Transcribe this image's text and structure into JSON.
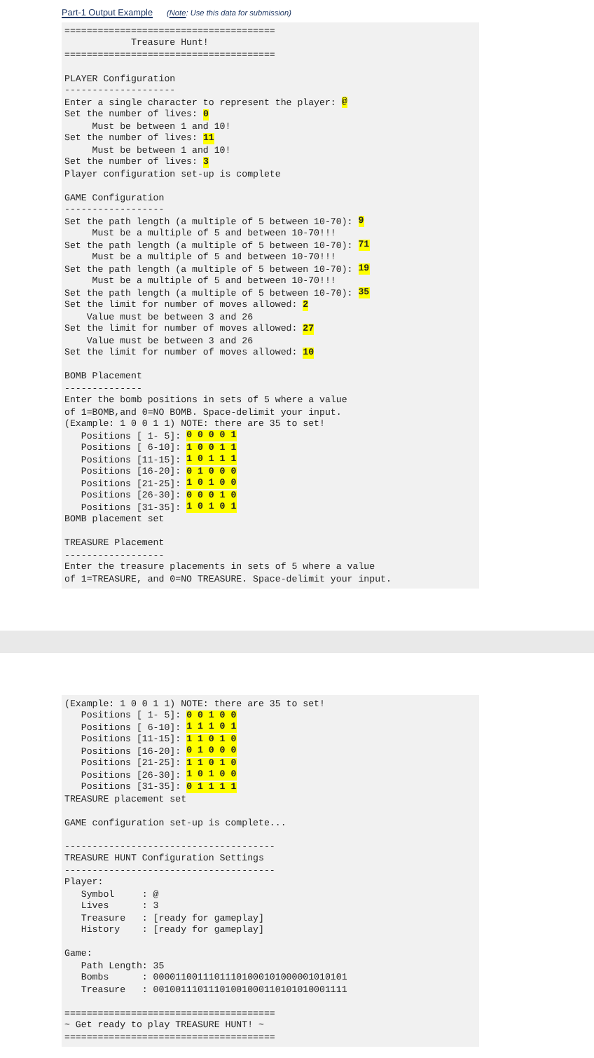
{
  "header": {
    "title": "Part-1 Output Example",
    "note": {
      "open": "(",
      "label": "Note",
      "rest": ": Use this data for submission)"
    }
  },
  "pages": [
    {
      "sections": [
        {
          "lines": [
            {
              "text": "======================================"
            },
            {
              "text": "            Treasure Hunt!"
            },
            {
              "text": "======================================"
            }
          ]
        },
        {
          "lines": [
            {
              "text": "PLAYER Configuration"
            },
            {
              "text": "--------------------"
            },
            {
              "text": "Enter a single character to represent the player: ",
              "input": "@"
            },
            {
              "text": "Set the number of lives: ",
              "input": "0"
            },
            {
              "text": "     Must be between 1 and 10!"
            },
            {
              "text": "Set the number of lives: ",
              "input": "11"
            },
            {
              "text": "     Must be between 1 and 10!"
            },
            {
              "text": "Set the number of lives: ",
              "input": "3"
            },
            {
              "text": "Player configuration set-up is complete"
            }
          ]
        },
        {
          "lines": [
            {
              "text": "GAME Configuration"
            },
            {
              "text": "------------------"
            },
            {
              "text": "Set the path length (a multiple of 5 between 10-70): ",
              "input": "9"
            },
            {
              "text": "     Must be a multiple of 5 and between 10-70!!!"
            },
            {
              "text": "Set the path length (a multiple of 5 between 10-70): ",
              "input": "71"
            },
            {
              "text": "     Must be a multiple of 5 and between 10-70!!!"
            },
            {
              "text": "Set the path length (a multiple of 5 between 10-70): ",
              "input": "19"
            },
            {
              "text": "     Must be a multiple of 5 and between 10-70!!!"
            },
            {
              "text": "Set the path length (a multiple of 5 between 10-70): ",
              "input": "35"
            },
            {
              "text": "Set the limit for number of moves allowed: ",
              "input": "2"
            },
            {
              "text": "    Value must be between 3 and 26"
            },
            {
              "text": "Set the limit for number of moves allowed: ",
              "input": "27"
            },
            {
              "text": "    Value must be between 3 and 26"
            },
            {
              "text": "Set the limit for number of moves allowed: ",
              "input": "10"
            }
          ]
        },
        {
          "lines": [
            {
              "text": "BOMB Placement"
            },
            {
              "text": "--------------"
            },
            {
              "text": "Enter the bomb positions in sets of 5 where a value"
            },
            {
              "text": "of 1=BOMB,and 0=NO BOMB. Space-delimit your input."
            },
            {
              "text": "(Example: 1 0 0 1 1) NOTE: there are 35 to set!"
            },
            {
              "text": "   Positions [ 1- 5]: ",
              "input": "0 0 0 0 1"
            },
            {
              "text": "   Positions [ 6-10]: ",
              "input": "1 0 0 1 1"
            },
            {
              "text": "   Positions [11-15]: ",
              "input": "1 0 1 1 1"
            },
            {
              "text": "   Positions [16-20]: ",
              "input": "0 1 0 0 0"
            },
            {
              "text": "   Positions [21-25]: ",
              "input": "1 0 1 0 0"
            },
            {
              "text": "   Positions [26-30]: ",
              "input": "0 0 0 1 0"
            },
            {
              "text": "   Positions [31-35]: ",
              "input": "1 0 1 0 1"
            },
            {
              "text": "BOMB placement set"
            }
          ]
        },
        {
          "lines": [
            {
              "text": "TREASURE Placement"
            },
            {
              "text": "------------------"
            },
            {
              "text": "Enter the treasure placements in sets of 5 where a value"
            },
            {
              "text": "of 1=TREASURE, and 0=NO TREASURE. Space-delimit your input."
            }
          ]
        }
      ]
    },
    {
      "sections": [
        {
          "lines": [
            {
              "text": "(Example: 1 0 0 1 1) NOTE: there are 35 to set!"
            },
            {
              "text": "   Positions [ 1- 5]: ",
              "input": "0 0 1 0 0"
            },
            {
              "text": "   Positions [ 6-10]: ",
              "input": "1 1 1 0 1"
            },
            {
              "text": "   Positions [11-15]: ",
              "input": "1 1 0 1 0"
            },
            {
              "text": "   Positions [16-20]: ",
              "input": "0 1 0 0 0"
            },
            {
              "text": "   Positions [21-25]: ",
              "input": "1 1 0 1 0"
            },
            {
              "text": "   Positions [26-30]: ",
              "input": "1 0 1 0 0"
            },
            {
              "text": "   Positions [31-35]: ",
              "input": "0 1 1 1 1"
            },
            {
              "text": "TREASURE placement set"
            }
          ]
        },
        {
          "lines": [
            {
              "text": "GAME configuration set-up is complete..."
            }
          ]
        },
        {
          "lines": [
            {
              "text": "--------------------------------------"
            },
            {
              "text": "TREASURE HUNT Configuration Settings"
            },
            {
              "text": "--------------------------------------"
            },
            {
              "text": "Player:"
            },
            {
              "text": "   Symbol     : @"
            },
            {
              "text": "   Lives      : 3"
            },
            {
              "text": "   Treasure   : [ready for gameplay]"
            },
            {
              "text": "   History    : [ready for gameplay]"
            }
          ]
        },
        {
          "lines": [
            {
              "text": "Game:"
            },
            {
              "text": "   Path Length: 35"
            },
            {
              "text": "   Bombs      : 00001100111011101000101000001010101"
            },
            {
              "text": "   Treasure   : 00100111011101001000110101010001111"
            }
          ]
        },
        {
          "lines": [
            {
              "text": "======================================"
            },
            {
              "text": "~ Get ready to play TREASURE HUNT! ~"
            },
            {
              "text": "======================================"
            }
          ]
        }
      ]
    }
  ]
}
